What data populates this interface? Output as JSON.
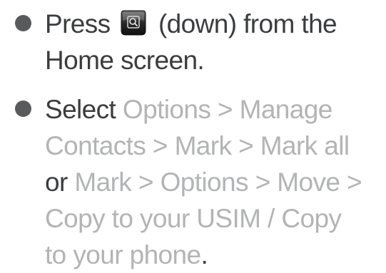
{
  "steps": [
    {
      "line1": {
        "before": "Press ",
        "key_icon": "search-key-icon",
        "after": " (down) from the"
      },
      "line2": "Home screen."
    },
    {
      "line1": {
        "text": "Select ",
        "menu": "Options > Manage"
      },
      "line2": {
        "menu": "Contacts > Mark > Mark all"
      },
      "line3": {
        "text": "or ",
        "menu": "Mark > Options > Move >"
      },
      "line4": {
        "menu": "Copy to your USIM / Copy"
      },
      "line5": {
        "menu": "to your phone",
        "text": "."
      }
    }
  ],
  "colors": {
    "body_text": "#3b3c3e",
    "menu_text": "#b3b4b5",
    "bullet": "#595a5c",
    "key_icon": "#2b2b2b"
  }
}
